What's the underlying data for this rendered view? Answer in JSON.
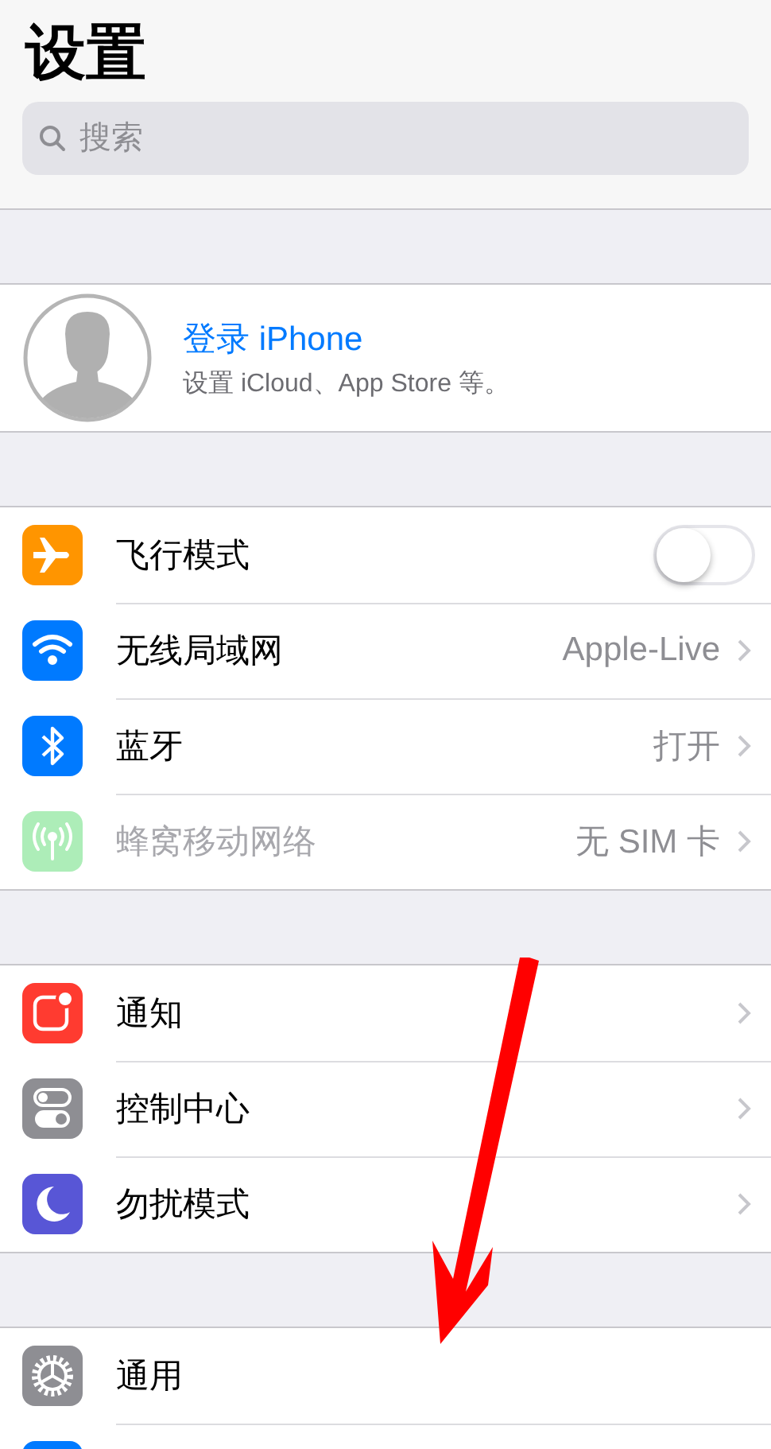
{
  "title": "设置",
  "search": {
    "placeholder": "搜索"
  },
  "account": {
    "title": "登录 iPhone",
    "subtitle": "设置 iCloud、App Store 等。"
  },
  "groups": [
    {
      "rows": [
        {
          "kind": "toggle",
          "label": "飞行模式",
          "on": false,
          "disabled": false
        },
        {
          "kind": "link",
          "label": "无线局域网",
          "value": "Apple-Live",
          "chevron": true,
          "disabled": false
        },
        {
          "kind": "link",
          "label": "蓝牙",
          "value": "打开",
          "chevron": true,
          "disabled": false
        },
        {
          "kind": "link",
          "label": "蜂窝移动网络",
          "value": "无 SIM 卡",
          "chevron": true,
          "disabled": true
        }
      ]
    },
    {
      "rows": [
        {
          "kind": "link",
          "label": "通知",
          "chevron": true,
          "disabled": false
        },
        {
          "kind": "link",
          "label": "控制中心",
          "chevron": true,
          "disabled": false
        },
        {
          "kind": "link",
          "label": "勿扰模式",
          "chevron": true,
          "disabled": false
        }
      ]
    },
    {
      "rows": [
        {
          "kind": "link",
          "label": "通用",
          "chevron": false,
          "disabled": false
        },
        {
          "kind": "partial"
        }
      ]
    }
  ],
  "annotation": {
    "kind": "arrow"
  }
}
